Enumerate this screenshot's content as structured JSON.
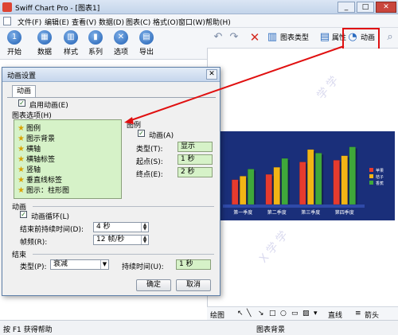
{
  "window": {
    "title": "Swiff Chart Pro - [图表1]",
    "controls": [
      "_",
      "□",
      "✕"
    ]
  },
  "menubar": [
    "文件(F)",
    "编辑(E)",
    "查看(V)",
    "数据(D)",
    "图表(C)",
    "格式(O)",
    "窗口(W)",
    "帮助(H)"
  ],
  "toolbar": [
    {
      "label": "开始",
      "icon": "start-icon",
      "glyph": "1"
    },
    {
      "label": "数据",
      "icon": "data-icon",
      "glyph": "▦"
    },
    {
      "label": "样式",
      "icon": "style-icon",
      "glyph": "▥"
    },
    {
      "label": "系列",
      "icon": "series-icon",
      "glyph": "▮"
    },
    {
      "label": "选项",
      "icon": "options-icon",
      "glyph": "✕"
    },
    {
      "label": "导出",
      "icon": "export-icon",
      "glyph": "▤"
    }
  ],
  "toolbar2": {
    "chart_type": "图表类型",
    "properties": "属性",
    "animation": "动画"
  },
  "dialog": {
    "title": "动画设置",
    "tab": "动画",
    "enable_animation": "启用动画(E)",
    "chart_options_label": "图表选项(H)",
    "list_items": [
      "图例",
      "图示背景",
      "横轴",
      "横轴标签",
      "竖轴",
      "垂直线标签",
      "图示：柱形图"
    ],
    "legend_group": "图例",
    "legend_animation": "动画(A)",
    "type_label": "类型(T):",
    "type_value": "显示",
    "start_label": "起点(S):",
    "start_value": "1 秒",
    "end_label": "终点(E):",
    "end_value": "2 秒",
    "animation_group": "动画",
    "loop": "动画循环(L)",
    "duration_label": "结束前持续时间(D):",
    "duration_value": "4 秒",
    "fps_label": "帧频(R):",
    "fps_value": "12 帧/秒",
    "end_group": "结束",
    "end_type_label": "类型(P):",
    "end_type_value": "衰减",
    "end_duration_label": "持续时间(U):",
    "end_duration_value": "1 秒",
    "ok": "确定",
    "cancel": "取消"
  },
  "chart_data": {
    "type": "bar",
    "categories": [
      "第一季度",
      "第二季度",
      "第三季度",
      "第四季度"
    ],
    "series": [
      {
        "name": "苹果",
        "values": [
          28,
          34,
          48,
          50
        ],
        "color": "#e63b2e"
      },
      {
        "name": "桔子",
        "values": [
          32,
          42,
          62,
          55
        ],
        "color": "#f2b515"
      },
      {
        "name": "香蕉",
        "values": [
          40,
          52,
          58,
          65
        ],
        "color": "#3fa83a"
      }
    ],
    "ylim": [
      0,
      70
    ],
    "grid": false,
    "legend": "right"
  },
  "bottombar": {
    "draw": "绘图",
    "line": "直线",
    "arrow": "箭头"
  },
  "status": {
    "help": "按 F1 获得帮助",
    "context": "图表背景"
  },
  "colors": {
    "accent_red": "#e01010",
    "listbox_bg": "#d6f2c8",
    "chart_bg": "#1a2f7a"
  }
}
